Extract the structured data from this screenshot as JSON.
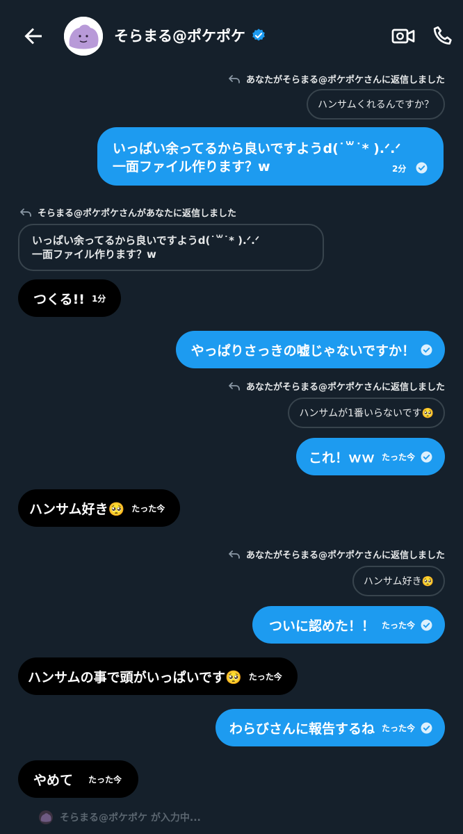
{
  "header": {
    "title": "そらまる@ポケポケ",
    "icons": [
      "back-arrow-icon",
      "verified-badge-icon",
      "video-call-icon",
      "phone-icon"
    ]
  },
  "messages": {
    "reply1_label": "あなたがそらまる@ポケポケさんに返信しました",
    "reply1_quote": "ハンサムくれるんですか？",
    "m1_line1": "いっぱい余ってるから良いですようd(˙꒳˙* ).ᐟ.ᐟ",
    "m1_line2": "一面ファイル作ります？w",
    "m1_time": "2分",
    "reply2_label": "そらまる@ポケポケさんがあなたに返信しました",
    "reply2_quote_line1": "いっぱい余ってるから良いですようd(˙꒳˙* ).ᐟ.ᐟ",
    "reply2_quote_line2": "一面ファイル作ります？w",
    "m2": "つくる!!",
    "m2_time": "1分",
    "m3": "やっぱりさっきの嘘じゃないですか！",
    "reply3_label": "あなたがそらまる@ポケポケさんに返信しました",
    "reply3_quote": "ハンサムが1番いらないです🥺",
    "m4": "これ！ｗｗ",
    "m4_time": "たった今",
    "m5": "ハンサム好き🥺",
    "m5_time": "たった今",
    "reply4_label": "あなたがそらまる@ポケポケさんに返信しました",
    "reply4_quote": "ハンサム好き🥺",
    "m6": "ついに認めた！！",
    "m6_time": "たった今",
    "m7": "ハンサムの事で頭がいっぱいです🥺",
    "m7_time": "たった今",
    "m8": "わらびさんに報告するね",
    "m8_time": "たった今",
    "m9": "やめて",
    "m9_time": "たった今"
  },
  "typing": "そらまる@ポケポケ が入力中..."
}
